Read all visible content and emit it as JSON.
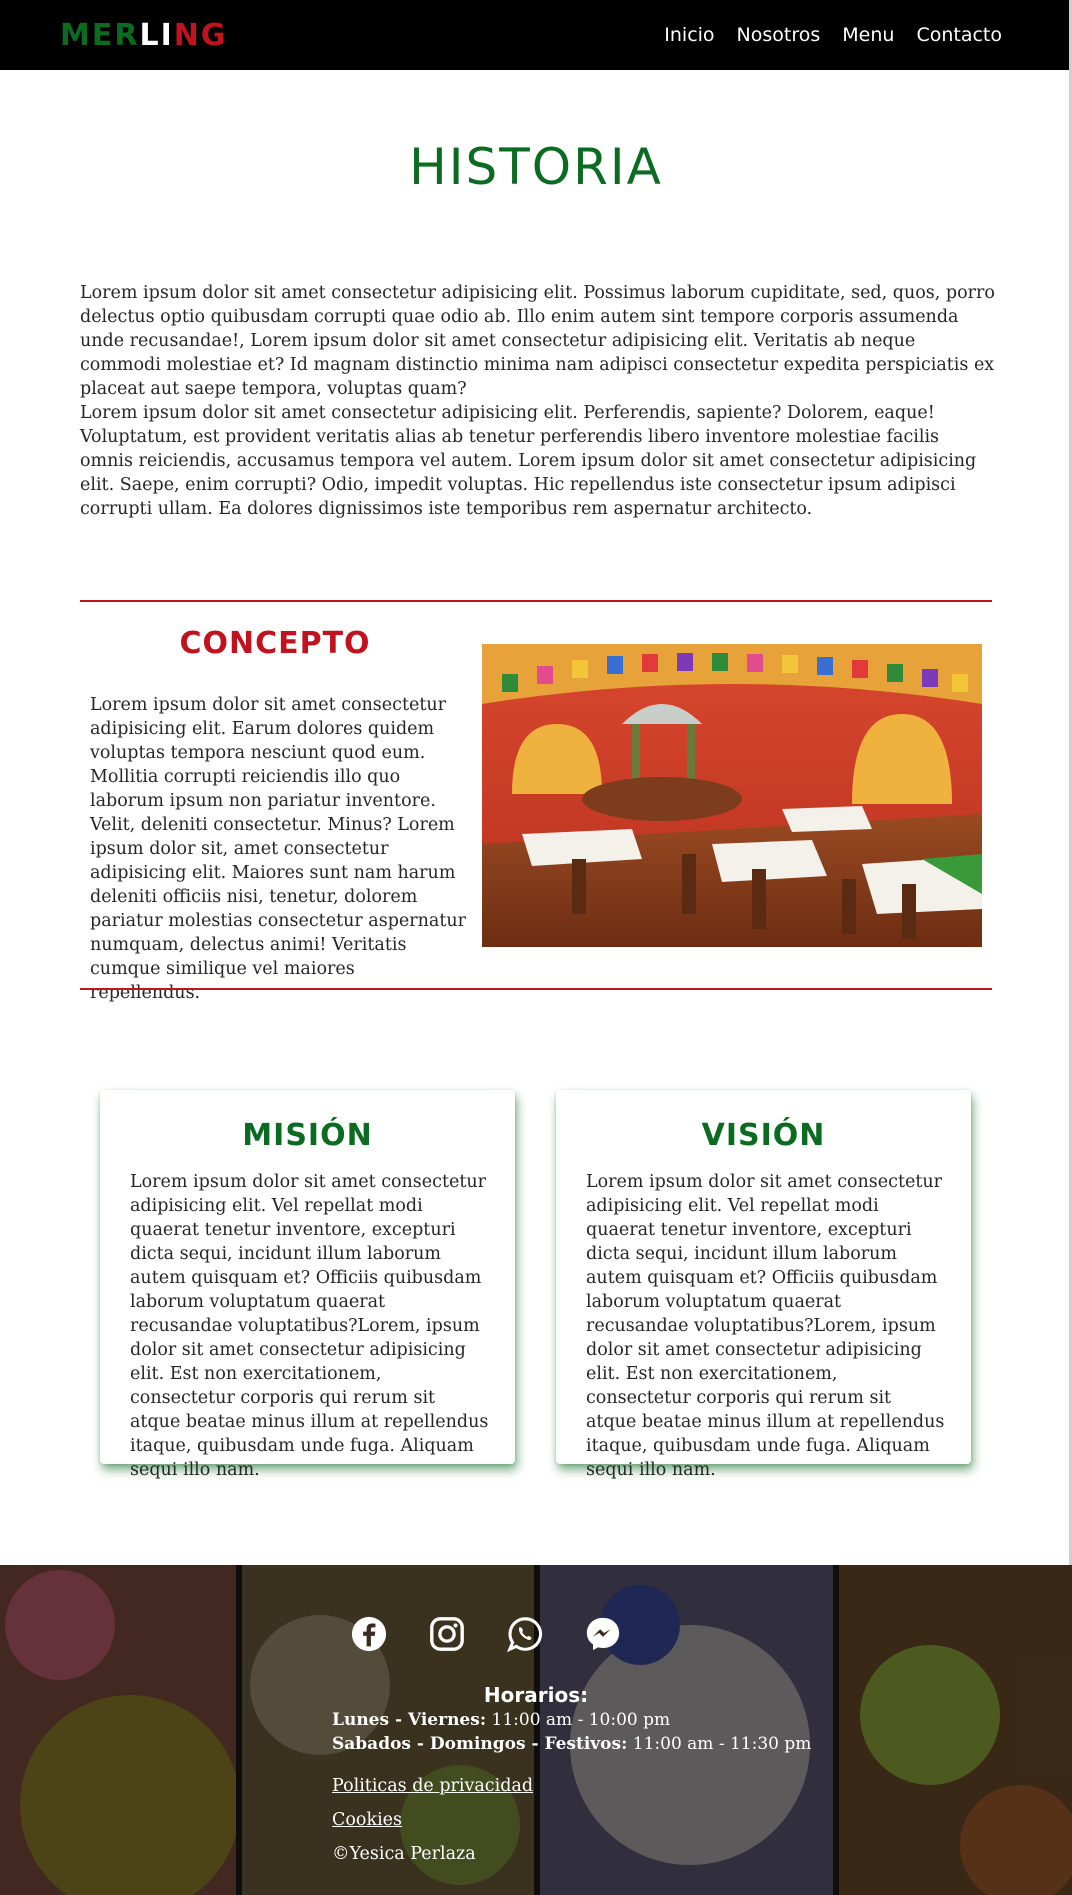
{
  "header": {
    "logo_letters": [
      {
        "char": "M",
        "color": "#0b6b21"
      },
      {
        "char": "E",
        "color": "#0b6b21"
      },
      {
        "char": "R",
        "color": "#0b6b21"
      },
      {
        "char": "L",
        "color": "#ffffff"
      },
      {
        "char": "I",
        "color": "#ffffff"
      },
      {
        "char": "N",
        "color": "#c0131d"
      },
      {
        "char": "G",
        "color": "#c0131d"
      }
    ],
    "nav": [
      "Inicio",
      "Nosotros",
      "Menu",
      "Contacto"
    ]
  },
  "historia": {
    "title": "HISTORIA",
    "paragraphs": [
      "Lorem ipsum dolor sit amet consectetur adipisicing elit. Possimus laborum cupiditate, sed, quos, porro delectus optio quibusdam corrupti quae odio ab. Illo enim autem sint tempore corporis assumenda unde recusandae!, Lorem ipsum dolor sit amet consectetur adipisicing elit. Veritatis ab neque commodi molestiae et? Id magnam distinctio minima nam adipisci consectetur expedita perspiciatis ex placeat aut saepe tempora, voluptas quam?",
      "Lorem ipsum dolor sit amet consectetur adipisicing elit. Perferendis, sapiente? Dolorem, eaque! Voluptatum, est provident veritatis alias ab tenetur perferendis libero inventore molestiae facilis omnis reiciendis, accusamus tempora vel autem. Lorem ipsum dolor sit amet consectetur adipisicing elit. Saepe, enim corrupti? Odio, impedit voluptas. Hic repellendus iste consectetur ipsum adipisci corrupti ullam. Ea dolores dignissimos iste temporibus rem aspernatur architecto."
    ]
  },
  "concepto": {
    "title": "CONCEPTO",
    "text": "Lorem ipsum dolor sit amet consectetur adipisicing elit. Earum dolores quidem voluptas tempora nesciunt quod eum. Mollitia corrupti reiciendis illo quo laborum ipsum non pariatur inventore. Velit, deleniti consectetur. Minus? Lorem ipsum dolor sit, amet consectetur adipisicing elit. Maiores sunt nam harum deleniti officiis nisi, tenetur, dolorem pariatur molestias consectetur aspernatur numquam, delectus animi! Veritatis cumque similique vel maiores repellendus."
  },
  "mision": {
    "title": "MISIÓN",
    "text": "Lorem ipsum dolor sit amet consectetur adipisicing elit. Vel repellat modi quaerat tenetur inventore, excepturi dicta sequi, incidunt illum laborum autem quisquam et? Officiis quibusdam laborum voluptatum quaerat recusandae voluptatibus?Lorem, ipsum dolor sit amet consectetur adipisicing elit. Est non exercitationem, consectetur corporis qui rerum sit atque beatae minus illum at repellendus itaque, quibusdam unde fuga. Aliquam sequi illo nam."
  },
  "vision": {
    "title": "VISIÓN",
    "text": "Lorem ipsum dolor sit amet consectetur adipisicing elit. Vel repellat modi quaerat tenetur inventore, excepturi dicta sequi, incidunt illum laborum autem quisquam et? Officiis quibusdam laborum voluptatum quaerat recusandae voluptatibus?Lorem, ipsum dolor sit amet consectetur adipisicing elit. Est non exercitationem, consectetur corporis qui rerum sit atque beatae minus illum at repellendus itaque, quibusdam unde fuga. Aliquam sequi illo nam."
  },
  "footer": {
    "social_icons": [
      "facebook-icon",
      "instagram-icon",
      "whatsapp-icon",
      "messenger-icon"
    ],
    "horarios_title": "Horarios:",
    "weekday_label": "Lunes - Viernes:",
    "weekday_hours": "11:00 am - 10:00 pm",
    "weekend_label": "Sabados - Domingos - Festivos:",
    "weekend_hours": "11:00 am - 11:30 pm",
    "links": [
      "Politicas de privacidad",
      "Cookies",
      "©Yesica Perlaza"
    ]
  },
  "colors": {
    "green": "#0b6b21",
    "red": "#c0131d",
    "header_bg": "#000000"
  }
}
